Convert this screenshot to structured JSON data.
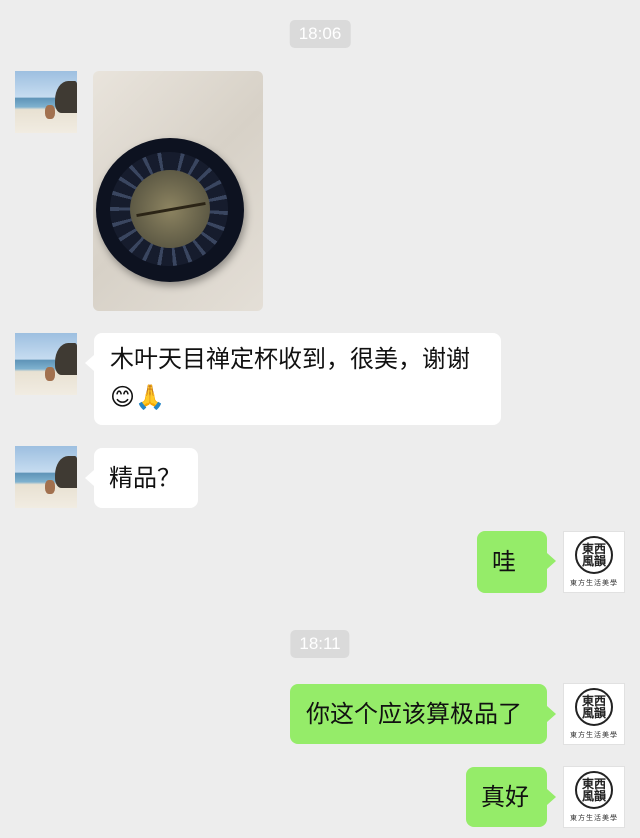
{
  "timestamps": [
    "18:06",
    "18:11"
  ],
  "messages": {
    "m2": "木叶天目禅定杯收到，很美，谢谢",
    "m2_emoji": "😊🙏",
    "m3": "精品？",
    "m4": "哇",
    "m5": "你这个应该算极品了",
    "m6": "真好"
  },
  "my_avatar": {
    "logo_text": "東西\n風韻",
    "caption": "東方生活美學"
  },
  "colors": {
    "background": "#ededed",
    "incoming_bubble": "#ffffff",
    "outgoing_bubble": "#95ec69",
    "timestamp_bg": "#dadada"
  }
}
